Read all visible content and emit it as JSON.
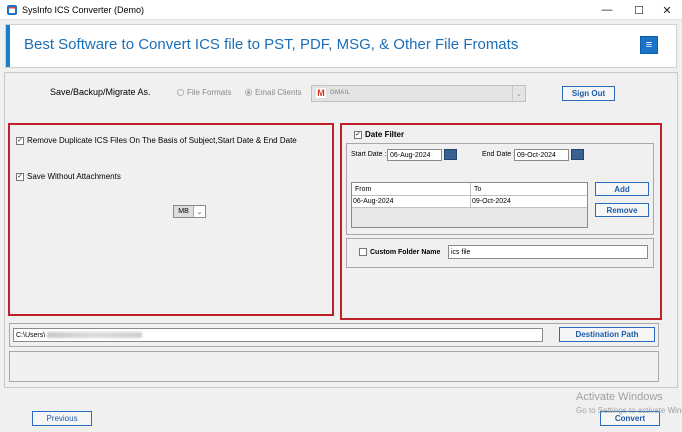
{
  "window": {
    "title": "SysInfo ICS Converter (Demo)",
    "minimize": "—",
    "maximize": "☐",
    "close": "✕"
  },
  "banner": {
    "title": "Best Software to Convert ICS file to PST, PDF, MSG, & Other File Fromats",
    "menu_icon": "≡"
  },
  "save_as": {
    "label": "Save/Backup/Migrate As.",
    "options": [
      "File Formats",
      "Email Clients"
    ],
    "selected_option": "Email Clients",
    "client_value": "GMAIL",
    "client_logo": "M",
    "dropdown_arrow": "⌄",
    "sign_out_label": "Sign Out"
  },
  "left_panel": {
    "remove_duplicate_label": "Remove Duplicate ICS Files On The Basis of Subject,Start Date & End Date",
    "remove_duplicate_checked": true,
    "save_without_attachments_label": "Save Without Attachments",
    "save_without_attachments_checked": true,
    "size_unit_value": "MB",
    "size_unit_arrow": "⌄"
  },
  "date_filter": {
    "label": "Date Filter",
    "checked": true,
    "start_date_label": "Start Date :",
    "start_date_value": "06-Aug-2024",
    "end_date_label": "End Date :",
    "end_date_value": "09-Oct-2024",
    "table_headers": [
      "From",
      "To"
    ],
    "table_rows": [
      [
        "06-Aug-2024",
        "09-Oct-2024"
      ]
    ],
    "add_label": "Add",
    "remove_label": "Remove",
    "custom_folder_label": "Custom Folder Name",
    "custom_folder_checked": false,
    "custom_folder_value": "ics file"
  },
  "destination": {
    "path_value": "C:\\Users\\",
    "button_label": "Destination Path"
  },
  "footer": {
    "previous_label": "Previous",
    "convert_label": "Convert"
  },
  "watermark": {
    "line1": "Activate Windows",
    "line2": "Go to Settings to activate Windows."
  },
  "colors": {
    "accent_blue": "#1a73c8",
    "banner_text": "#1b6fb8",
    "highlight_red": "#c0202a",
    "button_text": "#1c5ca8"
  }
}
